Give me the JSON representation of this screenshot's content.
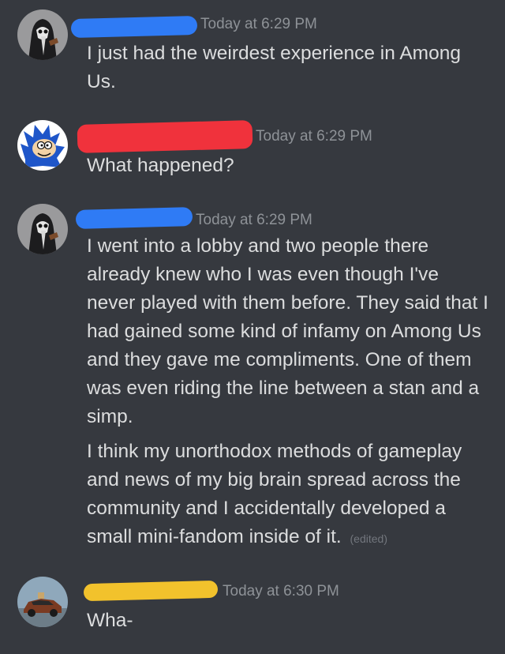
{
  "messages": [
    {
      "timestamp": "Today at 6:29 PM",
      "redaction_color": "#2f7bf5",
      "paragraphs": [
        "I just had the weirdest experience in Among Us."
      ]
    },
    {
      "timestamp": "Today at 6:29 PM",
      "redaction_color": "#f0323c",
      "paragraphs": [
        "What happened?"
      ]
    },
    {
      "timestamp": "Today at 6:29 PM",
      "redaction_color": "#2f7bf5",
      "paragraphs": [
        "I went into a lobby and two people there already knew who I was even though I've never played with them before. They said that I had gained some kind of infamy on Among Us and they gave me compliments. One of them was even riding the line between a stan and a simp.",
        "I think my unorthodox methods of gameplay and news of my big brain spread across the community and I accidentally developed a small mini-fandom inside of it."
      ],
      "edited_label": "(edited)"
    },
    {
      "timestamp": "Today at 6:30 PM",
      "redaction_color": "#f2c22c",
      "paragraphs": [
        "Wha-"
      ]
    }
  ],
  "colors": {
    "background": "#36393f",
    "message_text": "#dcddde",
    "timestamp_text": "#8e9297",
    "edited_text": "#72767d"
  }
}
